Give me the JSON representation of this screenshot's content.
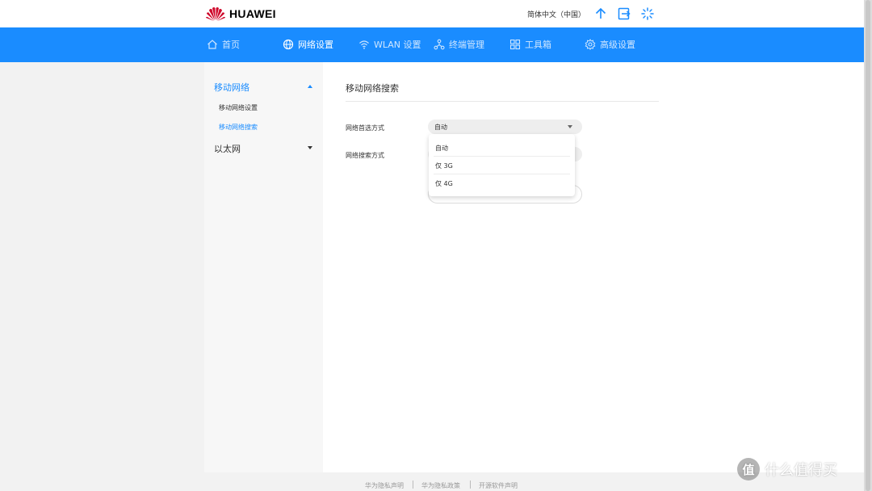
{
  "brand": {
    "name": "HUAWEI",
    "color": "#cf0a2c"
  },
  "header": {
    "language": "简体中文（中国）",
    "icons": [
      "upload-icon",
      "logout-icon",
      "loading-icon"
    ]
  },
  "nav": {
    "bg_color": "#1a8cff",
    "items": [
      {
        "label": "首页",
        "icon": "home-icon"
      },
      {
        "label": "网络设置",
        "icon": "globe-icon",
        "active": true
      },
      {
        "label": "WLAN 设置",
        "icon": "wifi-icon"
      },
      {
        "label": "终端管理",
        "icon": "devices-icon"
      },
      {
        "label": "工具箱",
        "icon": "toolbox-icon"
      },
      {
        "label": "高级设置",
        "icon": "gear-icon"
      }
    ]
  },
  "sidebar": {
    "groups": [
      {
        "label": "移动网络",
        "expanded": true,
        "items": [
          {
            "label": "移动网络设置"
          },
          {
            "label": "移动网络搜索",
            "active": true
          }
        ]
      },
      {
        "label": "以太网",
        "expanded": false
      }
    ]
  },
  "main": {
    "title": "移动网络搜索",
    "fields": [
      {
        "label": "网络首选方式",
        "value": "自动"
      },
      {
        "label": "网络搜索方式"
      }
    ],
    "dropdown_options": [
      "自动",
      "仅 3G",
      "仅 4G"
    ]
  },
  "footer": {
    "links": [
      "华为隐私声明",
      "华为隐私政策",
      "开源软件声明"
    ]
  },
  "watermark": {
    "badge": "值",
    "text": "什么值得买"
  }
}
